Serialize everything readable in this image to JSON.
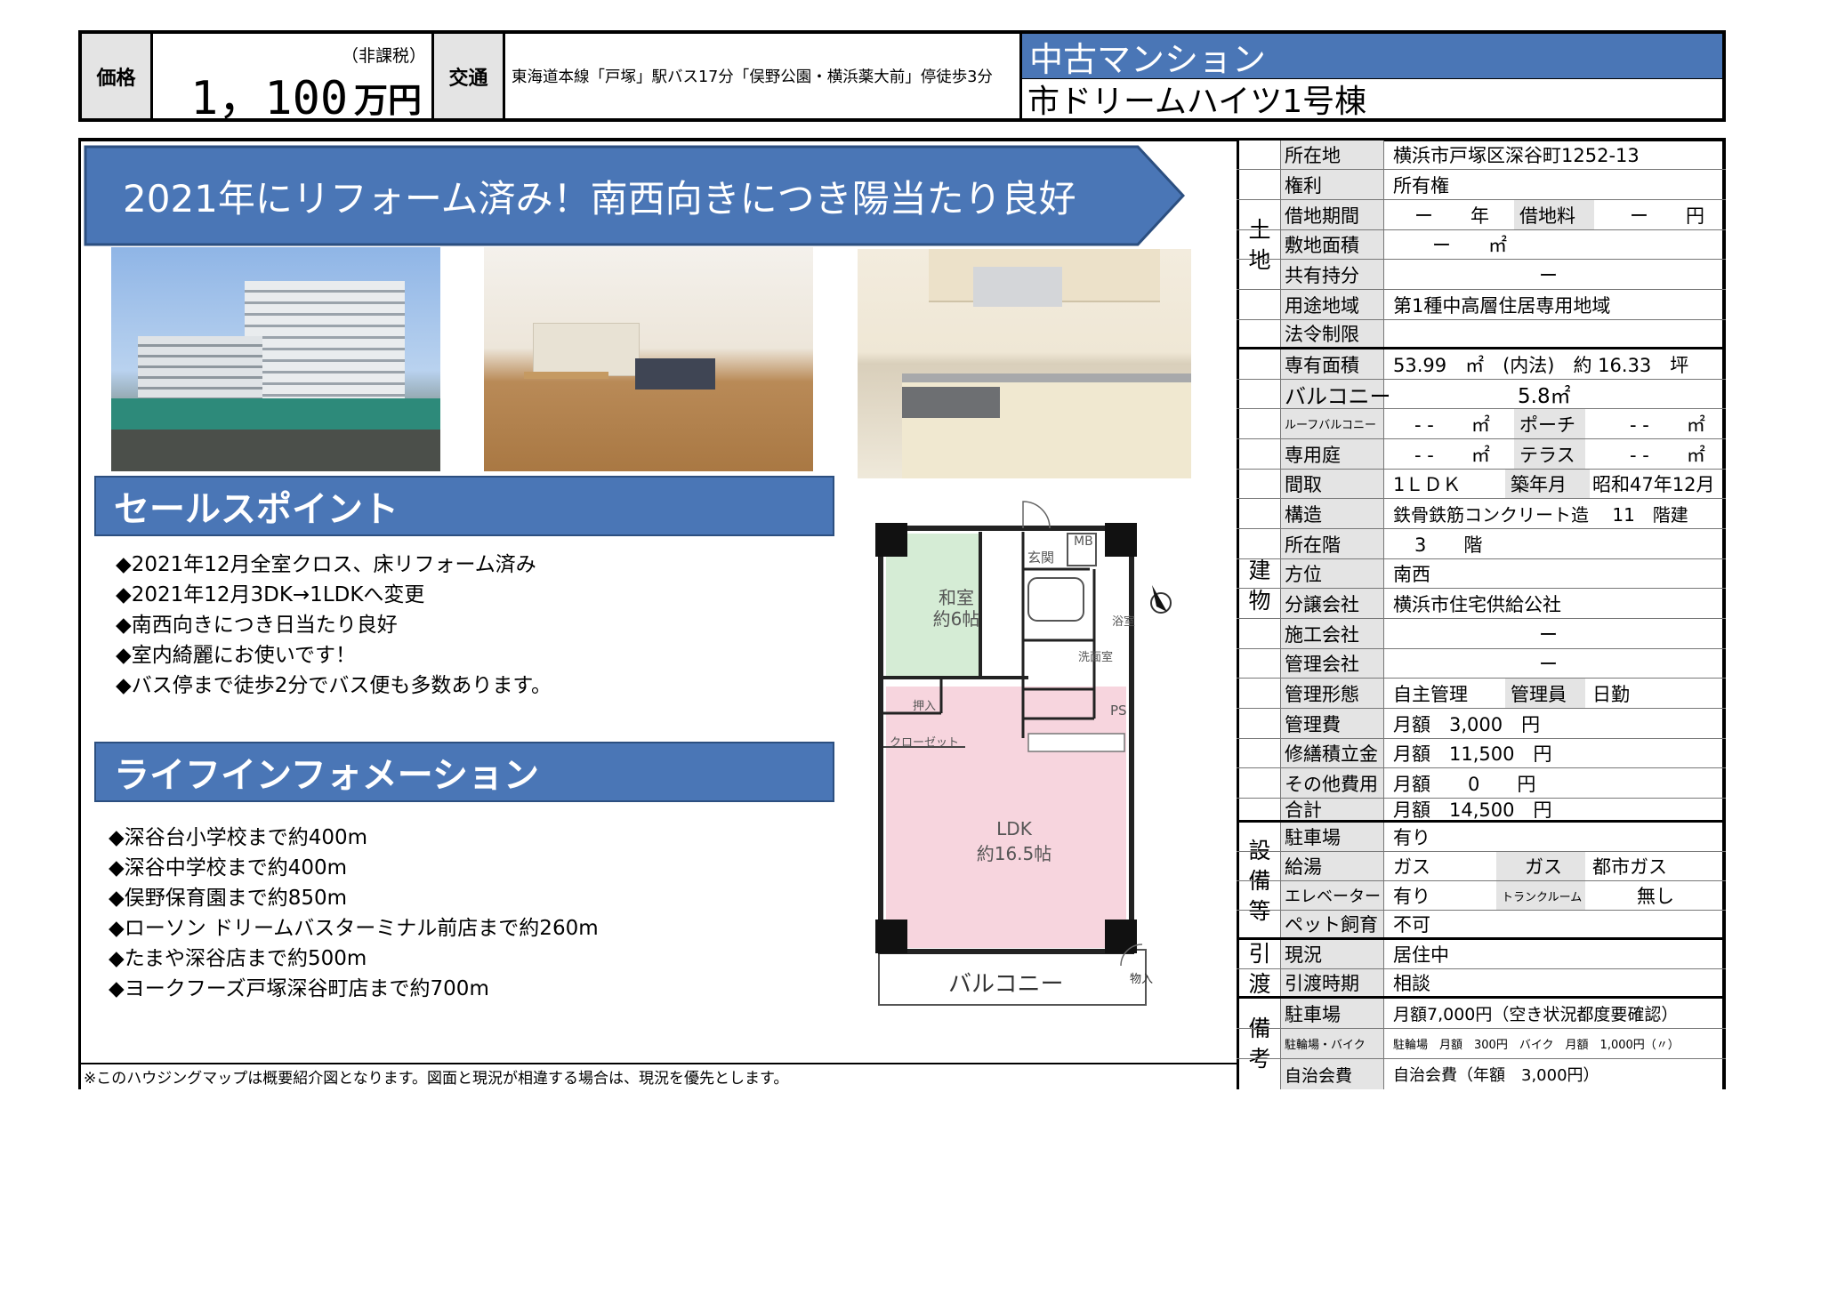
{
  "header": {
    "price_label": "価格",
    "price_value": "1，100",
    "price_tax": "（非課税）",
    "price_unit": "万円",
    "access_label": "交通",
    "access_value": "東海道本線「戸塚」駅バス17分「俣野公園・横浜薬大前」停徒歩3分",
    "type": "中古マンション",
    "name": "市ドリームハイツ1号棟"
  },
  "banner": "2021年にリフォーム済み！南西向きにつき陽当たり良好",
  "sales": {
    "title": "セールスポイント",
    "items": [
      "◆2021年12月全室クロス、床リフォーム済み",
      "◆2021年12月3DK→1LDKへ変更",
      "◆南西向きにつき日当たり良好",
      "◆室内綺麗にお使いです！",
      "◆バス停まで徒歩2分でバス便も多数あります。"
    ]
  },
  "life": {
    "title": "ライフインフォメーション",
    "items": [
      "◆深谷台小学校まで約400m",
      "◆深谷中学校まで約400m",
      "◆俣野保育園まで約850m",
      "◆ローソン ドリームバスターミナル前店まで約260m",
      "◆たまや深谷店まで約500m",
      "◆ヨークフーズ戸塚深谷町店まで約700m"
    ]
  },
  "floorplan": {
    "washitsu": "和室",
    "washitsu_size": "約6帖",
    "genkan": "玄関",
    "mb": "MB",
    "bath": "浴室",
    "senmen": "洗面室",
    "oshiire": "押入",
    "ps": "PS",
    "closet": "クローゼット",
    "ldk": "LDK",
    "ldk_size": "約16.5帖",
    "balcony": "バルコニー",
    "monoire": "物入"
  },
  "footer_note": "※このハウジングマップは概要紹介図となります。図面と現況が相違する場合は、現況を優先とします。",
  "groups": {
    "land": [
      "土",
      "地"
    ],
    "building": [
      "建",
      "物"
    ],
    "equip": [
      "設",
      "備",
      "等"
    ],
    "handover": [
      "引",
      "渡"
    ],
    "notes": [
      "備",
      "考"
    ]
  },
  "table": {
    "location_l": "所在地",
    "location_v": "横浜市戸塚区深谷町1252-13",
    "rights_l": "権利",
    "rights_v": "所有権",
    "lease_l": "借地期間",
    "lease_v": "ー　　年",
    "leasefee_l": "借地料",
    "leasefee_v": "ー　　円",
    "site_l": "敷地面積",
    "site_v": "ー　　㎡",
    "share_l": "共有持分",
    "share_v": "ー",
    "zone_l": "用途地域",
    "zone_v": "第1種中高層住居専用地域",
    "law_l": "法令制限",
    "law_v": "",
    "area_l": "専有面積",
    "area_v": "53.99　㎡　(内法)　約 16.33　坪",
    "balcony_l": "バルコニー",
    "balcony_v": "5.8㎡",
    "roof_l": "ルーフバルコニー",
    "roof_v": "- -　　㎡",
    "porch_l": "ポーチ",
    "porch_v": "- -　　㎡",
    "garden_l": "専用庭",
    "garden_v": "- -　　㎡",
    "terrace_l": "テラス",
    "terrace_v": "- -　　㎡",
    "layout_l": "間取",
    "layout_v": "1ＬＤＫ",
    "built_l": "築年月",
    "built_v": "昭和47年12月",
    "struct_l": "構造",
    "struct_v": "鉄骨鉄筋コンクリート造　 11　階建",
    "floor_l": "所在階",
    "floor_v": "3　　階",
    "dir_l": "方位",
    "dir_v": "南西",
    "seller_l": "分譲会社",
    "seller_v": "横浜市住宅供給公社",
    "builder_l": "施工会社",
    "builder_v": "ー",
    "mgmtco_l": "管理会社",
    "mgmtco_v": "ー",
    "mgmtform_l": "管理形態",
    "mgmtform_v": "自主管理",
    "manager_l": "管理員",
    "manager_v": "日勤",
    "mgmtfee_l": "管理費",
    "mgmtfee_v": "月額　3,000　円",
    "repair_l": "修繕積立金",
    "repair_v": "月額　11,500　円",
    "other_l": "その他費用",
    "other_v": "月額　　0　　円",
    "total_l": "合計",
    "total_v": "月額　14,500　円",
    "parking_l": "駐車場",
    "parking_v": "有り",
    "hotwater_l": "給湯",
    "hotwater_v": "ガス",
    "gas_l": "ガス",
    "gas_v": "都市ガス",
    "elev_l": "エレベーター",
    "elev_v": "有り",
    "trunk_l": "トランクルーム",
    "trunk_v": "無し",
    "pet_l": "ペット飼育",
    "pet_v": "不可",
    "status_l": "現況",
    "status_v": "居住中",
    "handover_l": "引渡時期",
    "handover_v": "相談",
    "n_parking_l": "駐車場",
    "n_parking_v": "月額7,000円（空き状況都度要確認）",
    "n_bike_l": "駐輪場・バイク",
    "n_bike_v": "駐輪場　月額　300円　バイク　月額　1,000円（〃）",
    "n_assoc_l": "自治会費",
    "n_assoc_v": "自治会費（年額　3,000円）"
  },
  "colors": {
    "accent": "#4a76b6",
    "label_bg": "#e4e4e4"
  }
}
